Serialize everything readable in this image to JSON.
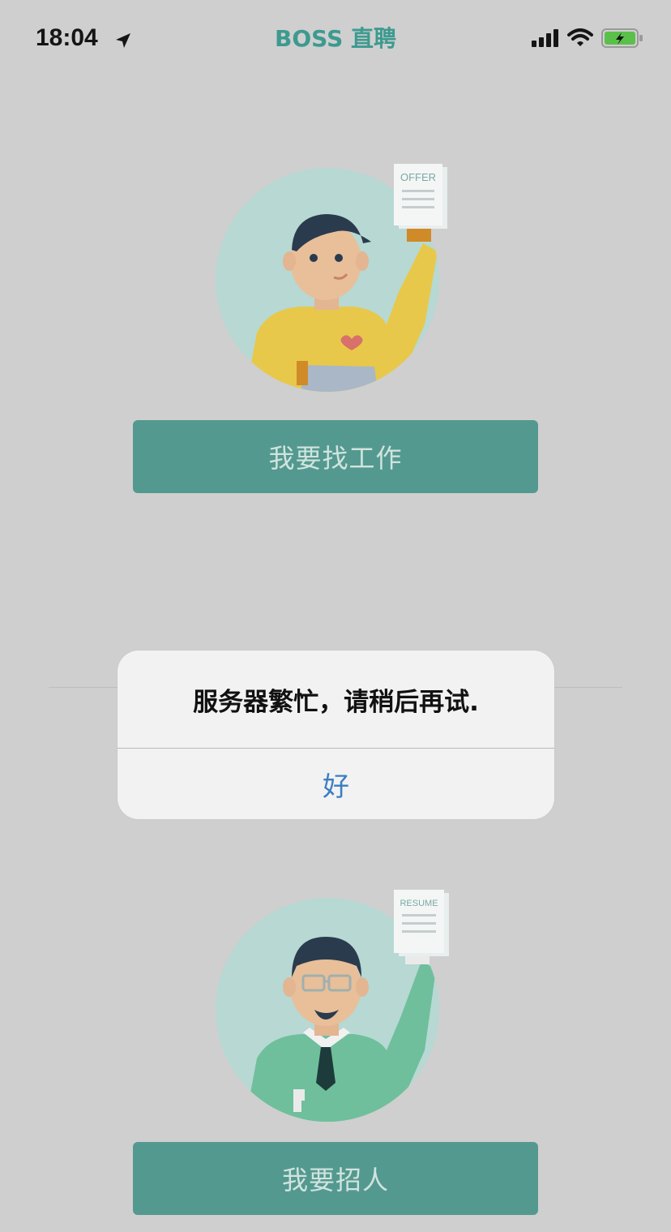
{
  "status_bar": {
    "time": "18:04",
    "app_title": "BOSS 直聘",
    "icons": [
      "location-arrow-icon",
      "signal-icon",
      "wifi-icon",
      "battery-charging-icon"
    ]
  },
  "job_seeker": {
    "illustration_label": "OFFER",
    "button_label": "我要找工作"
  },
  "recruiter": {
    "illustration_label": "RESUME",
    "button_label": "我要招人"
  },
  "alert": {
    "message": "服务器繁忙，请稍后再试.",
    "ok_label": "好"
  },
  "colors": {
    "brand": "#54998f",
    "title": "#3d9a8f",
    "alert_button": "#3a7ec4",
    "overlay_bg": "#cfcfcf"
  }
}
